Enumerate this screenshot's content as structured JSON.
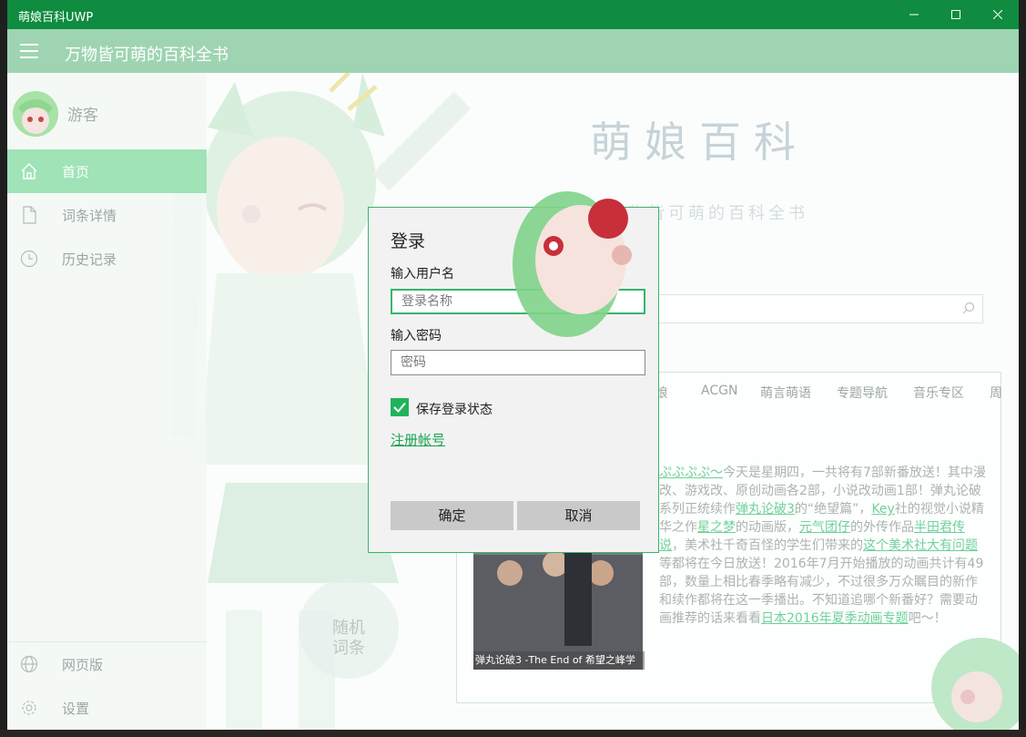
{
  "window": {
    "title": "萌娘百科UWP",
    "minimize_icon": "minimize-icon",
    "maximize_icon": "maximize-icon",
    "close_icon": "close-icon"
  },
  "header": {
    "title": "万物皆可萌的百科全书"
  },
  "sidebar": {
    "username": "游客",
    "items": [
      {
        "label": "首页",
        "icon": "home-icon",
        "active": true
      },
      {
        "label": "词条详情",
        "icon": "document-icon",
        "active": false
      },
      {
        "label": "历史记录",
        "icon": "clock-icon",
        "active": false
      }
    ],
    "bottom_items": [
      {
        "label": "网页版",
        "icon": "globe-icon"
      },
      {
        "label": "设置",
        "icon": "gear-icon"
      }
    ]
  },
  "home": {
    "logo_title": "萌娘百科",
    "logo_subtitle": "万物皆可萌的百科全书",
    "categories": [
      "ACGN",
      "萌言萌语",
      "专题导航",
      "音乐专区",
      "周"
    ],
    "categories_partial": [
      "...",
      "...",
      "...萌娘"
    ],
    "news": {
      "link1": "ぷぷぷぷ～",
      "text1": "今天是星期四，一共将有7部新番放送！其中漫改、游戏改、原创动画各2部，小说改动画1部！弹丸论破系列正统续作",
      "link2": "弹丸论破3",
      "text2": "的“绝望篇”，",
      "link3": "Key",
      "text3": "社的视觉小说精华之作",
      "link4": "星之梦",
      "text4": "的动画版，",
      "link5": "元气团仔",
      "text5": "的外传作品",
      "link6": "半田君传说",
      "text6": "，美术社千奇百怪的学生们带来的",
      "link7": "这个美术社大有问题",
      "text7": "等都将在今日放送！2016年7月开始播放的动画共计有49部，数量上相比春季略有减少，不过很多万众瞩目的新作和续作都将在这一季播出。不知道追哪个新番好？需要动画推荐的话来看看",
      "link8": "日本2016年夏季动画专题",
      "text8": "吧～！"
    },
    "thumb_caption": "弹丸论破3 -The End of 希望之峰学",
    "random_line1": "随机",
    "random_line2": "词条",
    "search_icon": "search-icon"
  },
  "login_dialog": {
    "title": "登录",
    "username_label": "输入用户名",
    "username_placeholder": "登录名称",
    "password_label": "输入密码",
    "password_placeholder": "密码",
    "remember_label": "保存登录状态",
    "remember_checked": true,
    "register_link": "注册帐号",
    "ok_button": "确定",
    "cancel_button": "取消"
  },
  "colors": {
    "titlebar": "#0f8c3f",
    "header": "#9fd4b2",
    "accent": "#21b35c",
    "nav_active": "#9fe3b7"
  }
}
